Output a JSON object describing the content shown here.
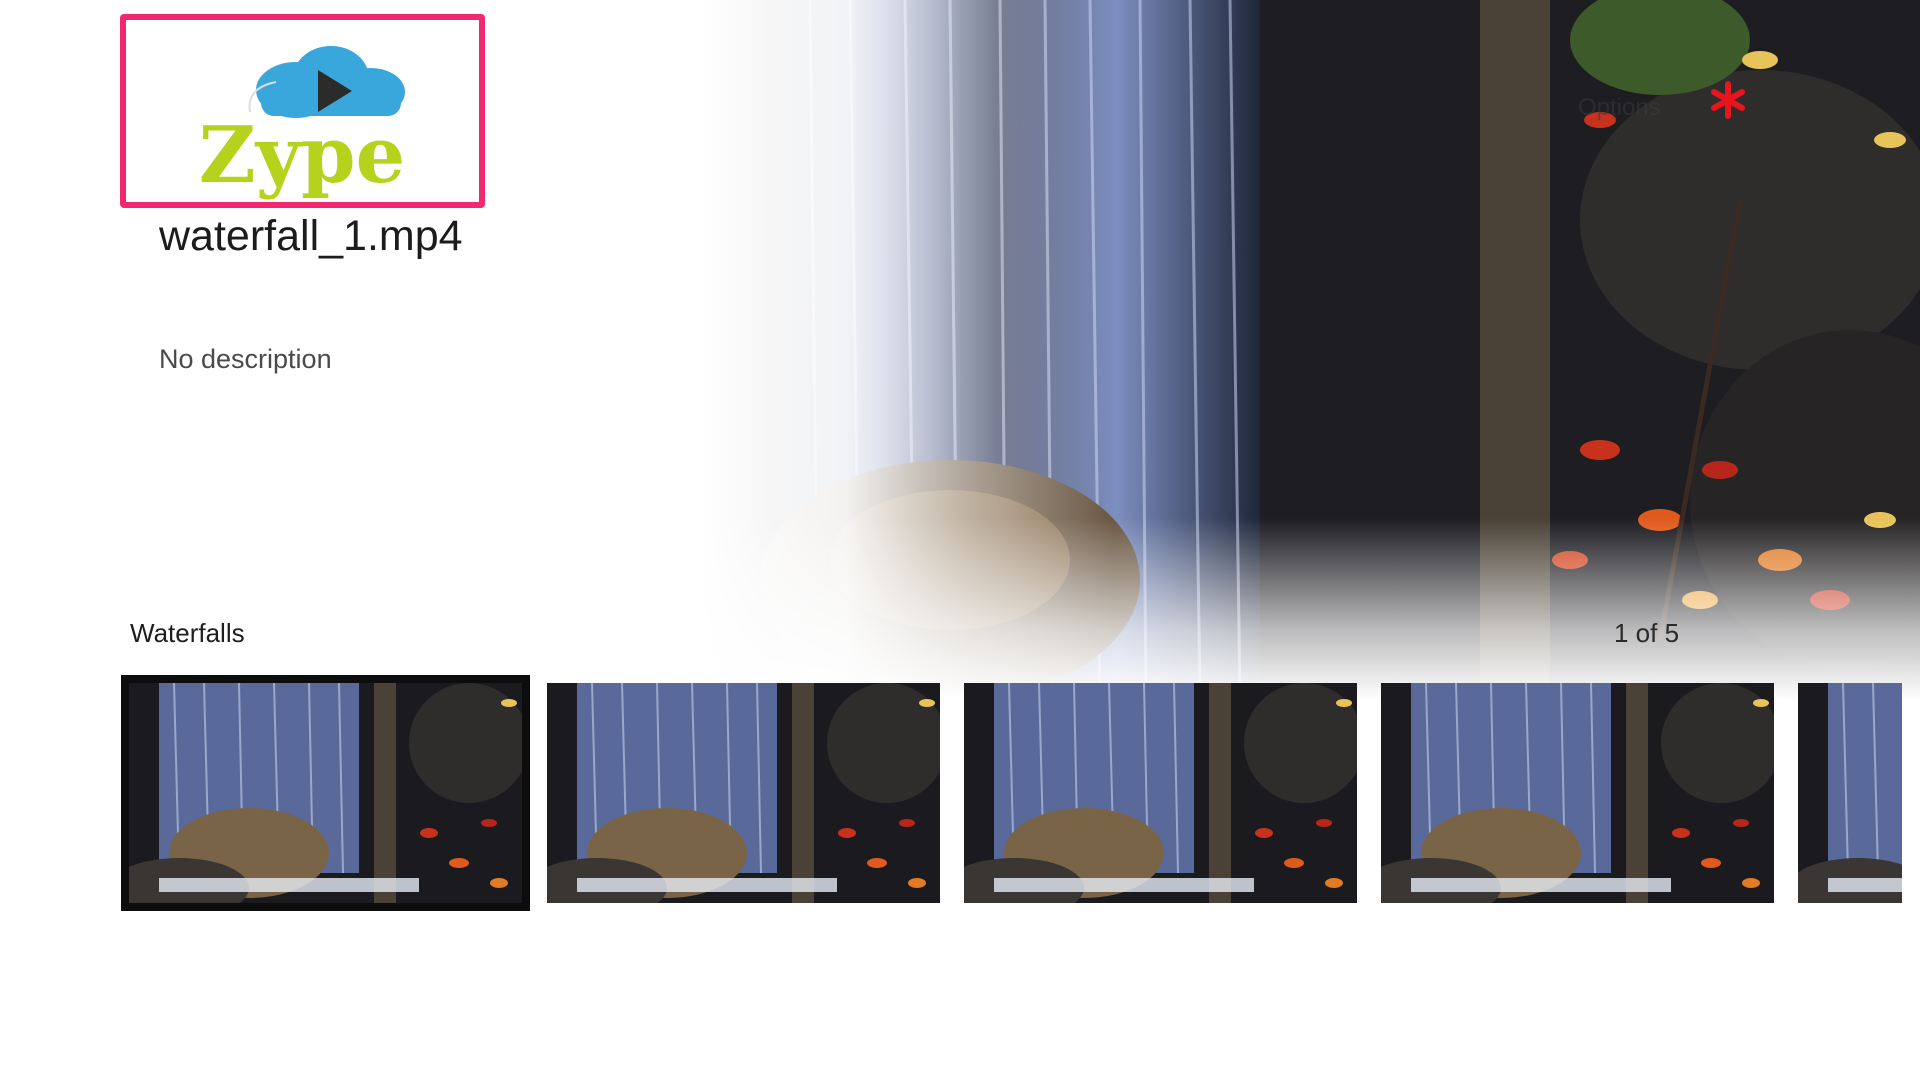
{
  "app": {
    "brand": "Zype"
  },
  "video": {
    "title": "waterfall_1.mp4",
    "description": "No description"
  },
  "header": {
    "options_label": "Options",
    "options_icon": "asterisk-icon",
    "options_icon_color": "#e8141e"
  },
  "playlist": {
    "title": "Waterfalls",
    "counter": "1 of 5",
    "focused_index": 0,
    "items_visible": 5
  },
  "colors": {
    "focus_border": "#f1286f",
    "logo_green": "#b6d21c",
    "logo_cloud": "#3aa7dc",
    "thumb_focus_border": "#0d0d0d"
  }
}
